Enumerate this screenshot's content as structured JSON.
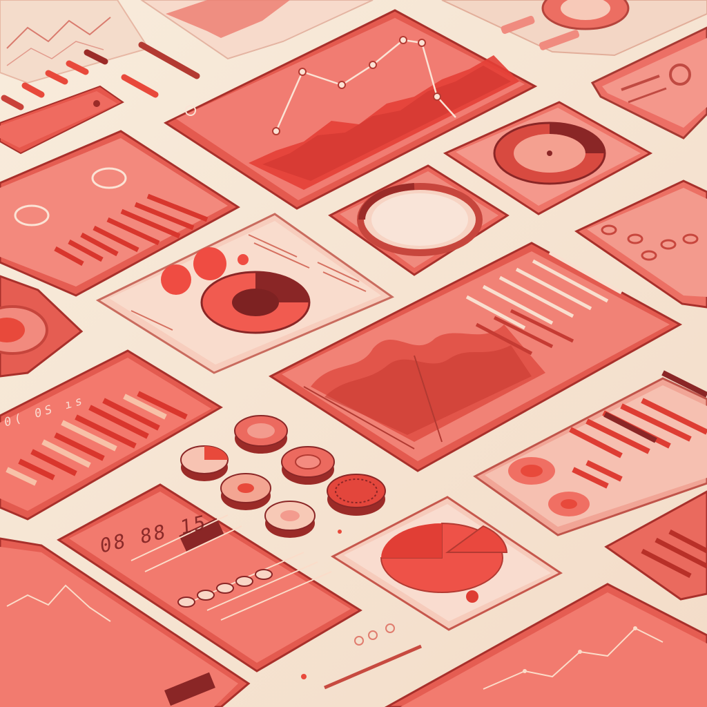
{
  "scene": {
    "colors": {
      "background": "#f6e6d4",
      "panel": "#f07d74",
      "panel_light": "#f4a898",
      "panel_pale": "#f7cfc0",
      "accent": "#e64b3e",
      "dark": "#8a2626",
      "line": "#fbefe4"
    },
    "readout_text": "08 88 15",
    "cluster_text": "0( 0S ıs"
  }
}
